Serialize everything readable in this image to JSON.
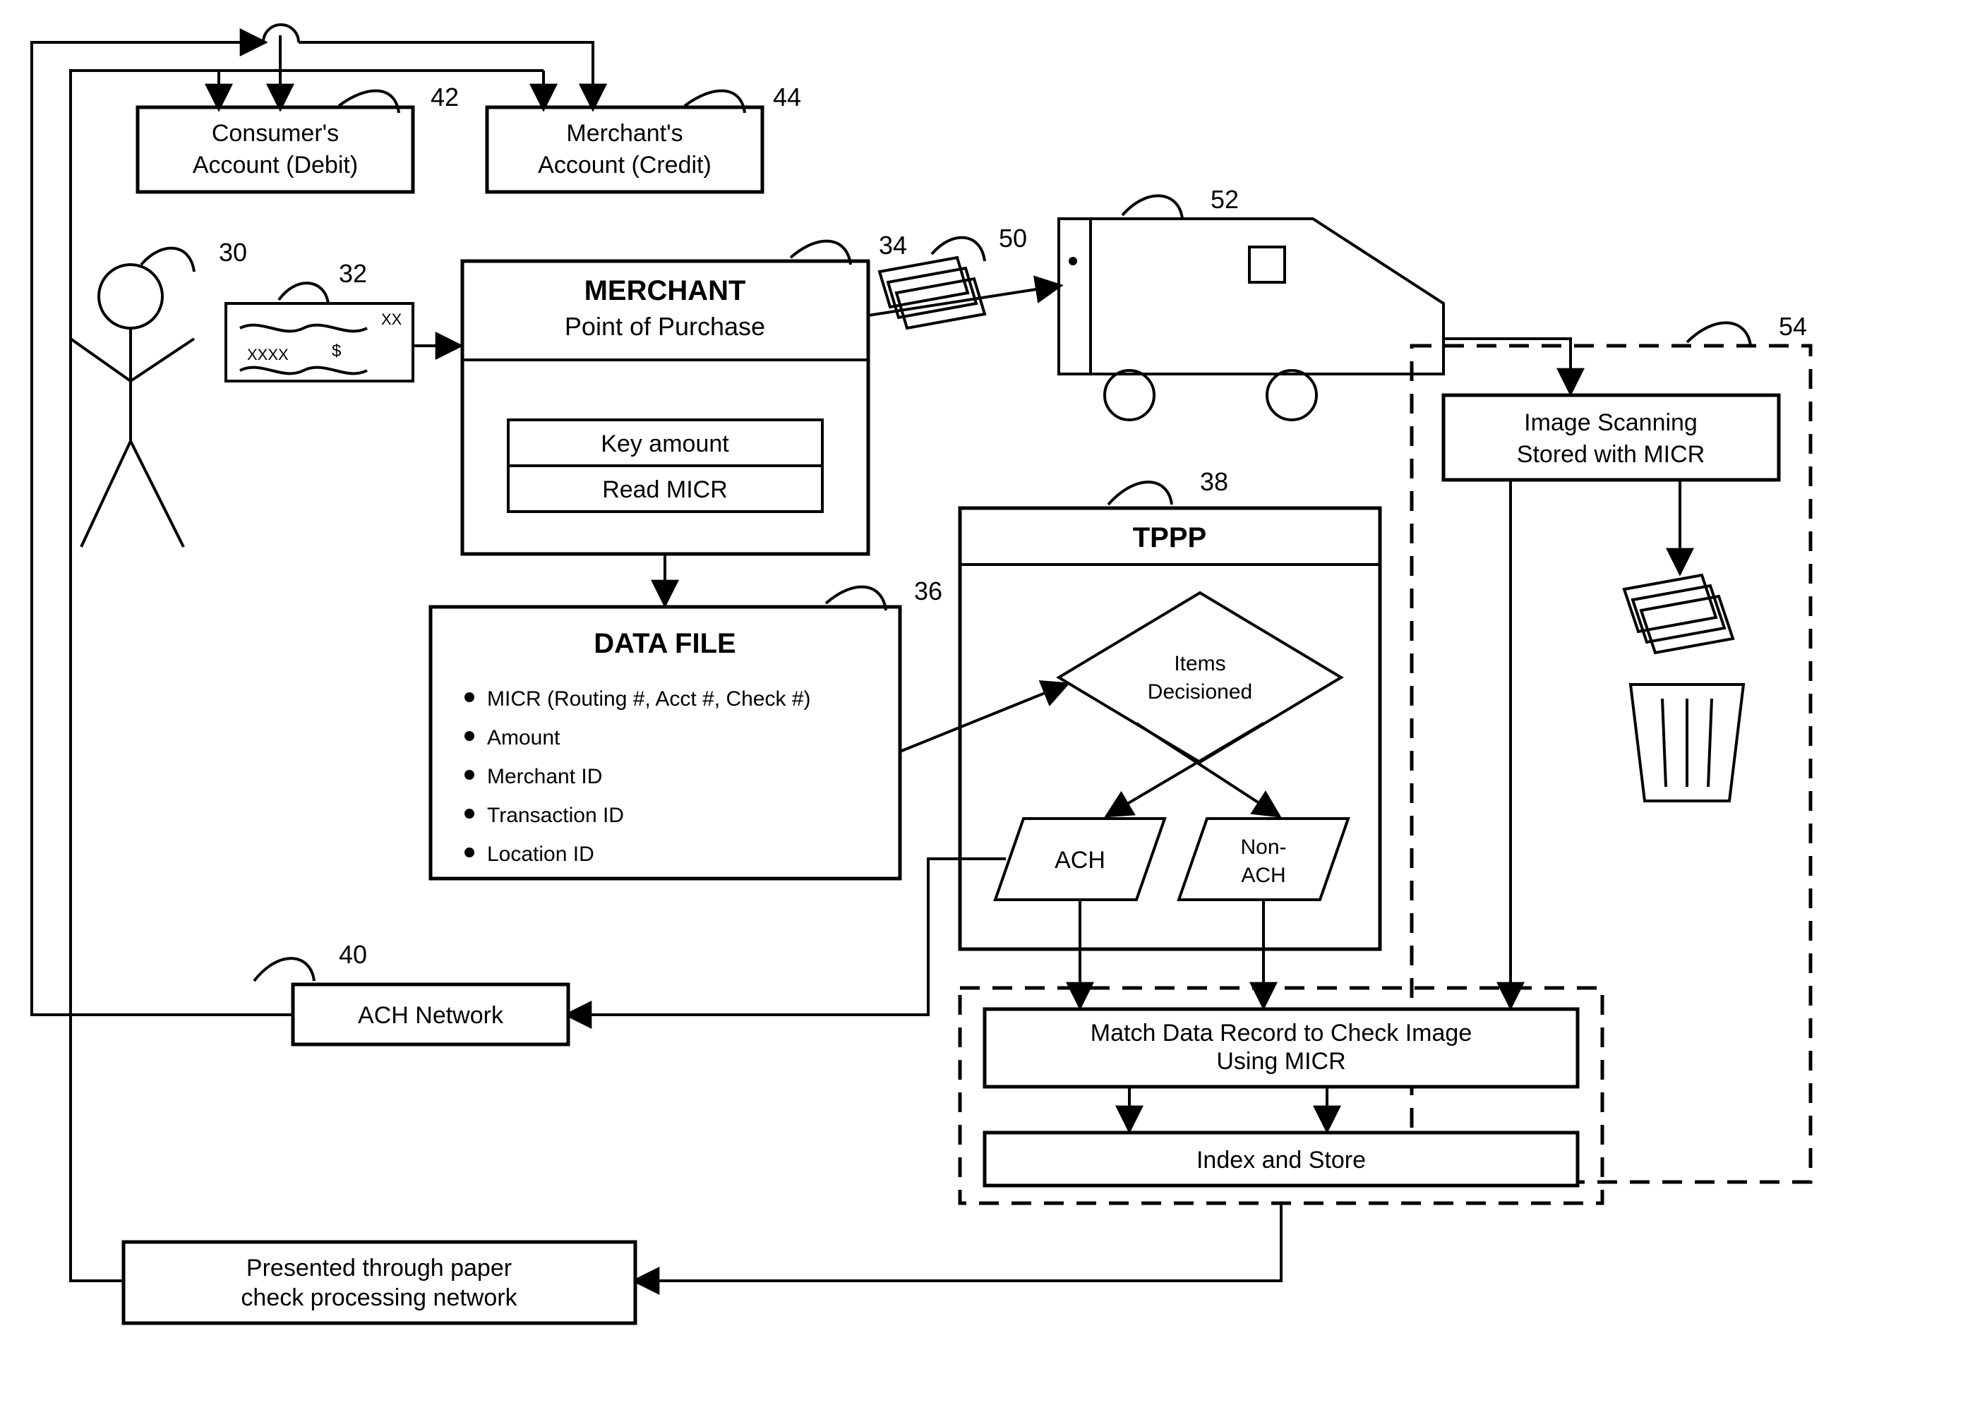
{
  "refs": {
    "r30": "30",
    "r32": "32",
    "r34": "34",
    "r36": "36",
    "r38": "38",
    "r40": "40",
    "r42": "42",
    "r44": "44",
    "r50": "50",
    "r52": "52",
    "r54": "54"
  },
  "boxes": {
    "consumer_account_l1": "Consumer's",
    "consumer_account_l2": "Account (Debit)",
    "merchant_account_l1": "Merchant's",
    "merchant_account_l2": "Account (Credit)",
    "merchant_title": "MERCHANT",
    "merchant_subtitle": "Point of Purchase",
    "key_amount": "Key amount",
    "read_micr": "Read MICR",
    "data_file_title": "DATA FILE",
    "data_file_b1": "MICR (Routing #, Acct #, Check #)",
    "data_file_b2": "Amount",
    "data_file_b3": "Merchant ID",
    "data_file_b4": "Transaction ID",
    "data_file_b5": "Location ID",
    "tppp_title": "TPPP",
    "items_l1": "Items",
    "items_l2": "Decisioned",
    "ach": "ACH",
    "nonach_l1": "Non-",
    "nonach_l2": "ACH",
    "ach_network": "ACH Network",
    "image_scanning_l1": "Image Scanning",
    "image_scanning_l2": "Stored with MICR",
    "match_l1": "Match Data Record to Check Image",
    "match_l2": "Using MICR",
    "index_store": "Index and Store",
    "presented_l1": "Presented through paper",
    "presented_l2": "check processing network"
  },
  "check": {
    "xxxx": "XXXX",
    "dollar": "$",
    "xx": "XX"
  }
}
